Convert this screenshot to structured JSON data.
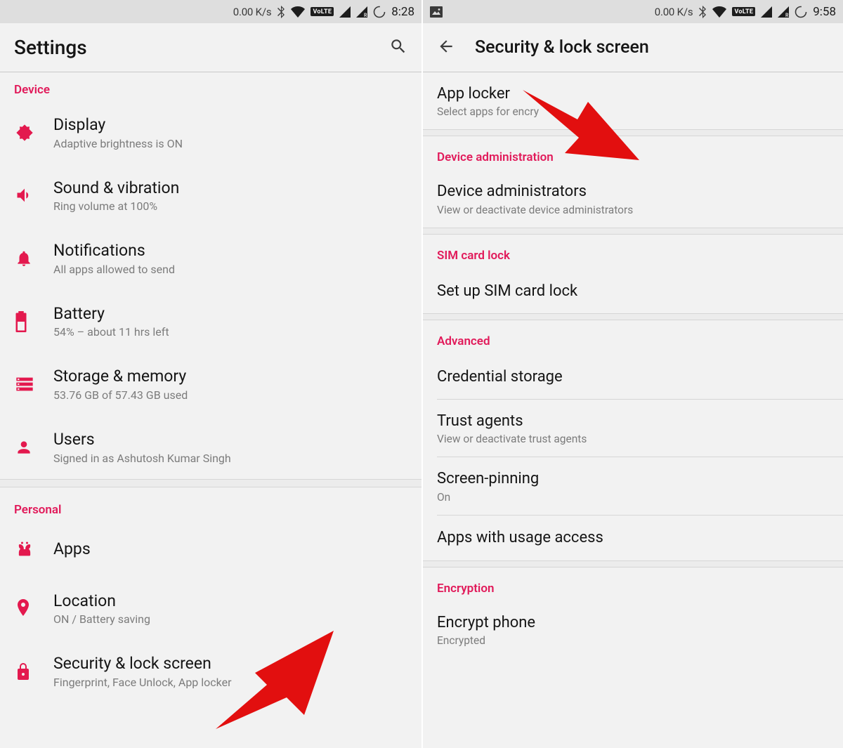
{
  "left": {
    "status": {
      "speed": "0.00 K/s",
      "volte": "VoLTE",
      "time": "8:28"
    },
    "title": "Settings",
    "sections": [
      {
        "header": "Device",
        "items": [
          {
            "icon": "display",
            "title": "Display",
            "sub": "Adaptive brightness is ON"
          },
          {
            "icon": "sound",
            "title": "Sound & vibration",
            "sub": "Ring volume at 100%"
          },
          {
            "icon": "notifications",
            "title": "Notifications",
            "sub": "All apps allowed to send"
          },
          {
            "icon": "battery",
            "title": "Battery",
            "sub": "54% – about 11 hrs left"
          },
          {
            "icon": "storage",
            "title": "Storage & memory",
            "sub": "53.76 GB of 57.43 GB used"
          },
          {
            "icon": "users",
            "title": "Users",
            "sub": "Signed in as Ashutosh Kumar Singh"
          }
        ]
      },
      {
        "header": "Personal",
        "items": [
          {
            "icon": "apps",
            "title": "Apps",
            "sub": ""
          },
          {
            "icon": "location",
            "title": "Location",
            "sub": "ON / Battery saving"
          },
          {
            "icon": "security",
            "title": "Security & lock screen",
            "sub": "Fingerprint, Face Unlock, App locker"
          }
        ]
      }
    ]
  },
  "right": {
    "status": {
      "speed": "0.00 K/s",
      "volte": "VoLTE",
      "time": "9:58"
    },
    "title": "Security & lock screen",
    "groups": [
      {
        "header": "",
        "items": [
          {
            "title": "App locker",
            "sub": "Select apps for encry"
          }
        ]
      },
      {
        "header": "Device administration",
        "items": [
          {
            "title": "Device administrators",
            "sub": "View or deactivate device administrators"
          }
        ]
      },
      {
        "header": "SIM card lock",
        "items": [
          {
            "title": "Set up SIM card lock",
            "sub": ""
          }
        ]
      },
      {
        "header": "Advanced",
        "items": [
          {
            "title": "Credential storage",
            "sub": ""
          },
          {
            "title": "Trust agents",
            "sub": "View or deactivate trust agents"
          },
          {
            "title": "Screen-pinning",
            "sub": "On"
          },
          {
            "title": "Apps with usage access",
            "sub": ""
          }
        ]
      },
      {
        "header": "Encryption",
        "items": [
          {
            "title": "Encrypt phone",
            "sub": "Encrypted"
          }
        ]
      }
    ]
  },
  "accent": "#e3194e"
}
